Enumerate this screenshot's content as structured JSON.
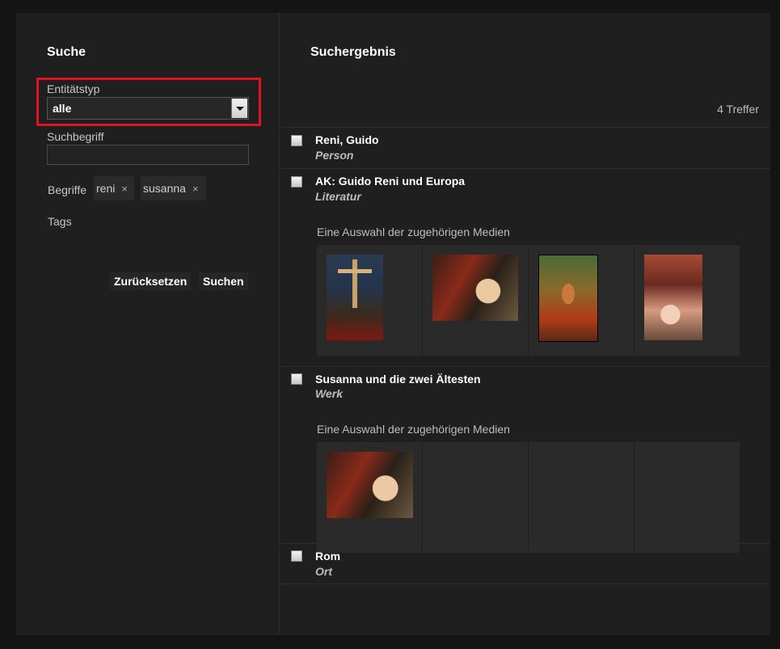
{
  "search": {
    "title": "Suche",
    "entity_type_label": "Entitätstyp",
    "entity_type_value": "alle",
    "term_label": "Suchbegriff",
    "term_value": "",
    "begriffe_label": "Begriffe",
    "chips": [
      {
        "label": "reni",
        "remove": "×"
      },
      {
        "label": "susanna",
        "remove": "×"
      }
    ],
    "tags_label": "Tags",
    "reset_label": "Zurücksetzen",
    "search_label": "Suchen"
  },
  "results": {
    "title": "Suchergebnis",
    "count": "4 Treffer",
    "media_label": "Eine Auswahl der zugehörigen Medien",
    "items": [
      {
        "title": "Reni, Guido",
        "type": "Person"
      },
      {
        "title": "AK: Guido Reni und Europa",
        "type": "Literatur"
      },
      {
        "title": "Susanna und die zwei Ältesten",
        "type": "Werk"
      },
      {
        "title": "Rom",
        "type": "Ort"
      }
    ]
  },
  "colors": {
    "highlight": "#e0141e",
    "background": "#1f1f1f"
  }
}
